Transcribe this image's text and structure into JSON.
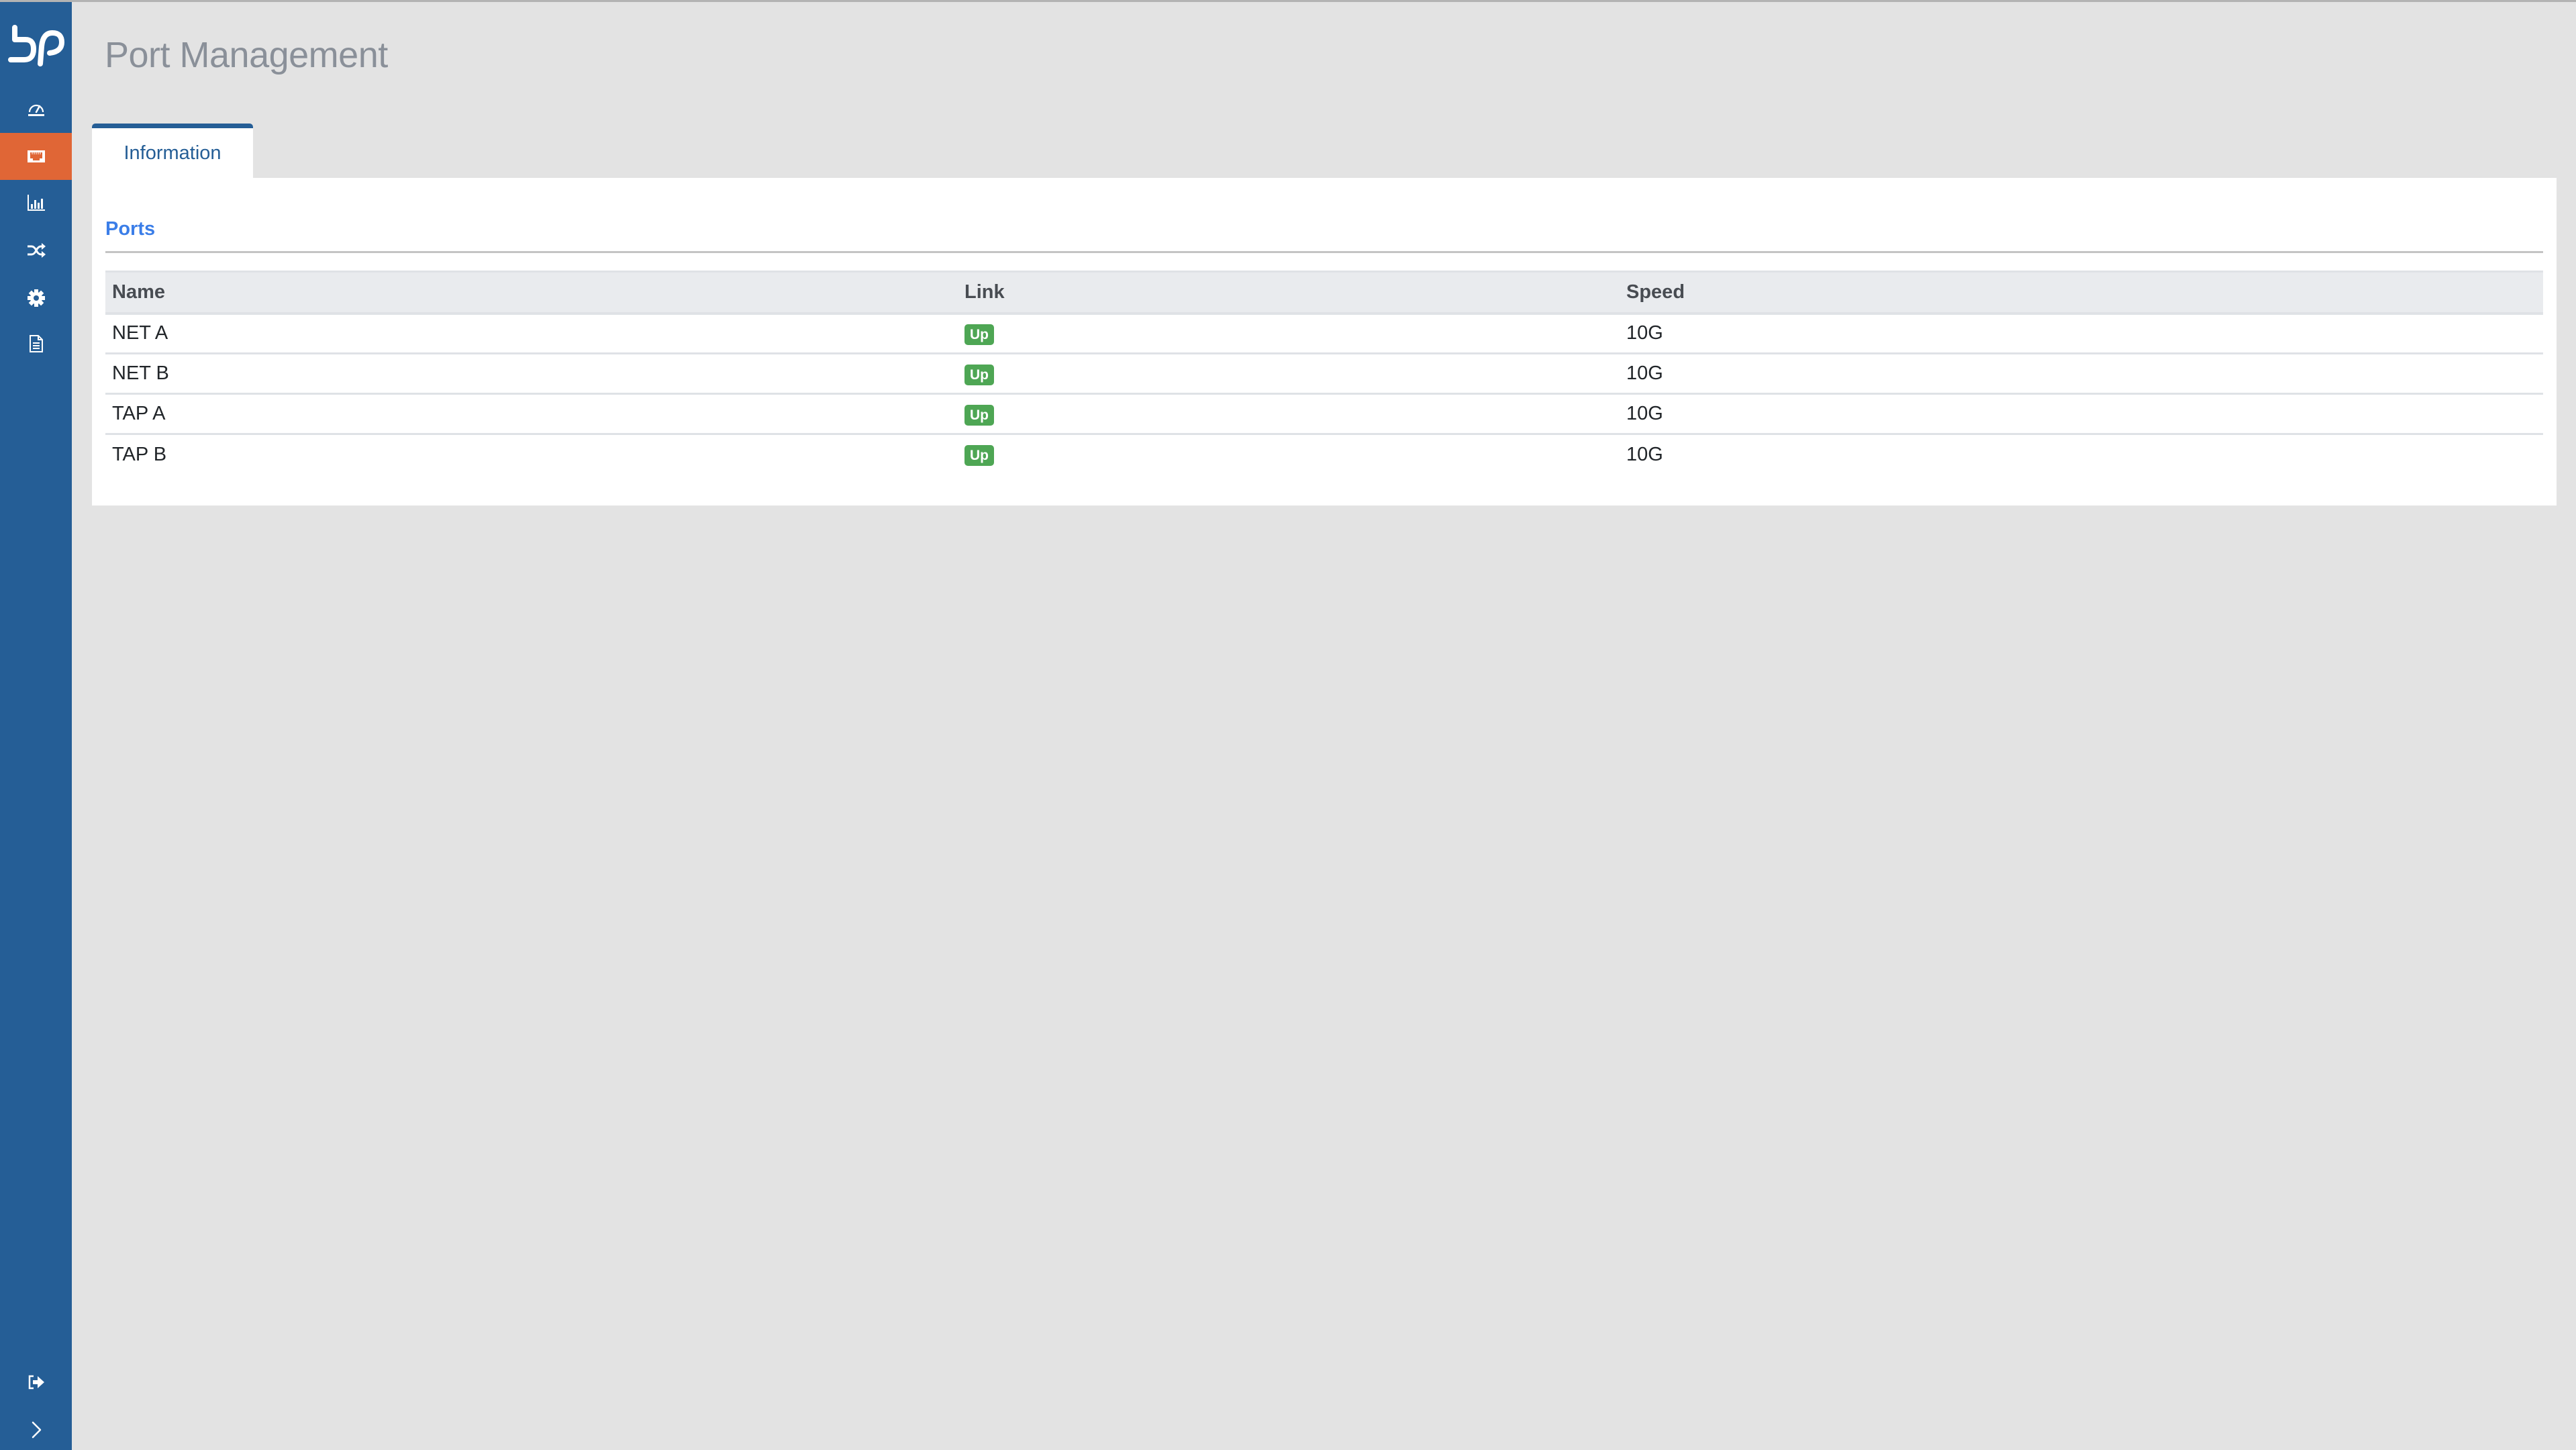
{
  "app": {
    "logo_text": "bP"
  },
  "sidebar": {
    "items": [
      {
        "id": "dashboard",
        "icon": "gauge-icon",
        "active": false
      },
      {
        "id": "ports",
        "icon": "ethernet-port-icon",
        "active": true
      },
      {
        "id": "statistics",
        "icon": "bar-chart-icon",
        "active": false
      },
      {
        "id": "traffic",
        "icon": "shuffle-icon",
        "active": false
      },
      {
        "id": "settings",
        "icon": "gear-icon",
        "active": false
      },
      {
        "id": "logs",
        "icon": "document-icon",
        "active": false
      }
    ],
    "bottom_items": [
      {
        "id": "logout",
        "icon": "sign-out-icon"
      },
      {
        "id": "expand",
        "icon": "chevron-right-icon"
      }
    ],
    "colors": {
      "background": "#255e96",
      "active": "#e06636"
    }
  },
  "header": {
    "title": "Port Management"
  },
  "tabs": [
    {
      "label": "Information",
      "active": true
    }
  ],
  "section": {
    "title": "Ports"
  },
  "table": {
    "columns": [
      "Name",
      "Link",
      "Speed"
    ],
    "rows": [
      {
        "name": "NET A",
        "link": "Up",
        "speed": "10G"
      },
      {
        "name": "NET B",
        "link": "Up",
        "speed": "10G"
      },
      {
        "name": "TAP A",
        "link": "Up",
        "speed": "10G"
      },
      {
        "name": "TAP B",
        "link": "Up",
        "speed": "10G"
      }
    ],
    "link_up_color": "#4ea654"
  }
}
